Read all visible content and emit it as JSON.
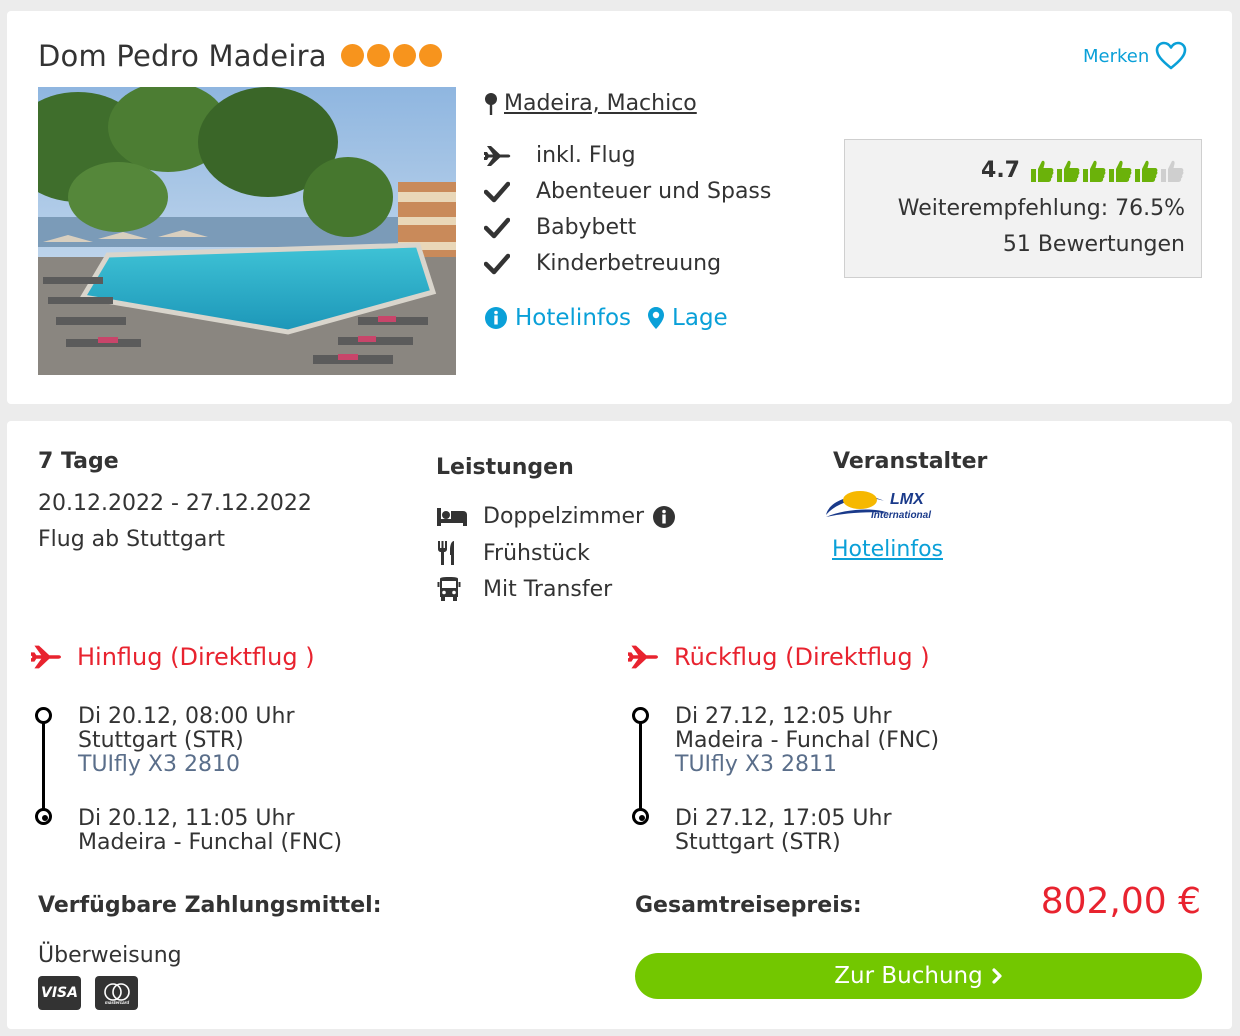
{
  "hotel": {
    "name": "Dom Pedro Madeira",
    "stars": 4,
    "star_color": "#f7941d",
    "location": "Madeira, Machico",
    "merken_label": "Merken",
    "features": [
      "inkl. Flug",
      "Abenteuer und Spass",
      "Babybett",
      "Kinderbetreuung"
    ],
    "links": {
      "hotelinfos": "Hotelinfos",
      "lage": "Lage"
    }
  },
  "rating": {
    "score": "4.7",
    "thumbs_total": 6,
    "thumbs_filled": 5,
    "recommendation": "Weiterempfehlung: 76.5%",
    "reviews": "51 Bewertungen"
  },
  "trip": {
    "duration": "7 Tage",
    "dates": "20.12.2022 - 27.12.2022",
    "departure": "Flug ab Stuttgart"
  },
  "leistungen": {
    "title": "Leistungen",
    "items": [
      "Doppelzimmer",
      "Frühstück",
      "Mit Transfer"
    ]
  },
  "veranstalter": {
    "title": "Veranstalter",
    "logo_text": "LMX",
    "logo_sub": "International",
    "link": "Hotelinfos"
  },
  "flights": {
    "outbound": {
      "title": "Hinflug (Direktflug )",
      "dep_time": "Di 20.12, 08:00 Uhr",
      "dep_airport": "Stuttgart (STR)",
      "airline": "TUIfly X3 2810",
      "arr_time": "Di 20.12, 11:05 Uhr",
      "arr_airport": "Madeira - Funchal (FNC)"
    },
    "return": {
      "title": "Rückflug (Direktflug )",
      "dep_time": "Di 27.12, 12:05 Uhr",
      "dep_airport": "Madeira - Funchal (FNC)",
      "airline": "TUIfly X3 2811",
      "arr_time": "Di 27.12, 17:05 Uhr",
      "arr_airport": "Stuttgart (STR)"
    }
  },
  "payment": {
    "title": "Verfügbare Zahlungsmittel:",
    "methods": [
      "Überweisung"
    ],
    "card_visa": "VISA",
    "card_mc": "mastercard"
  },
  "price": {
    "label": "Gesamtreisepreis:",
    "value": "802,00 €",
    "book_label": "Zur Buchung"
  },
  "colors": {
    "accent_blue": "#0aa0d8",
    "flight_red": "#e8232f",
    "book_green": "#73c700",
    "thumb_green": "#6bb20a"
  }
}
